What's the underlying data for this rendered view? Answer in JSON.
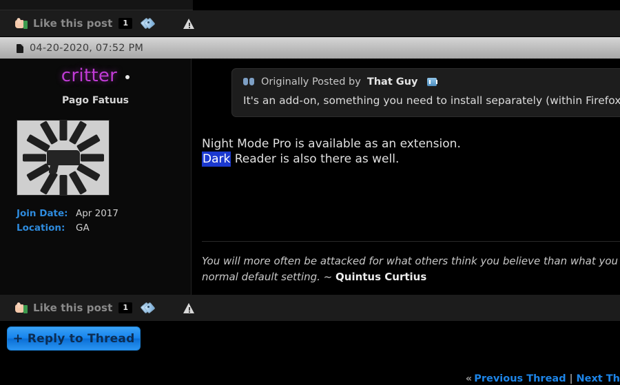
{
  "like_bar": {
    "thumb_icon": "thumbs-up-icon",
    "label": "Like this post",
    "count": "1",
    "tag_icon": "tag-icon",
    "report_icon": "warning-triangle-icon"
  },
  "post": {
    "date_icon": "page-icon",
    "date": "04-20-2020, 07:52 PM",
    "user": {
      "username": "critter",
      "online_indicator": "online-dot",
      "title": "Pago Fatuus",
      "avatar_alt": "pistol-and-magazines-avatar",
      "fields": [
        {
          "key": "Join Date:",
          "value": "Apr 2017"
        },
        {
          "key": "Location:",
          "value": "GA"
        }
      ]
    },
    "quote": {
      "quote_icon": "quote-marks-icon",
      "prefix": "Originally Posted by",
      "author": "That Guy",
      "badge_icon": "view-post-icon",
      "text": "It's an add-on, something you need to install separately (within Firefox)."
    },
    "body_line_1": "Night Mode Pro is available as an extension.",
    "body_selected": "Dark",
    "body_line_2_rest": " Reader is also there as well.",
    "signature_line_1": "You will more often be attacked for what others think you believe than what you",
    "signature_line_2_prefix": "normal default setting. ~ ",
    "signature_attribution": "Quintus Curtius"
  },
  "reply_button": {
    "plus": "+",
    "label": "Reply to Thread"
  },
  "thread_nav": {
    "chevron": "«",
    "previous": "Previous Thread",
    "separator": "|",
    "next": "Next Th"
  },
  "colors": {
    "username": "#c13bd6",
    "link": "#1d85e8",
    "field_label": "#2e8bdd",
    "selection": "#1b39cf",
    "button": "#1683ed"
  }
}
